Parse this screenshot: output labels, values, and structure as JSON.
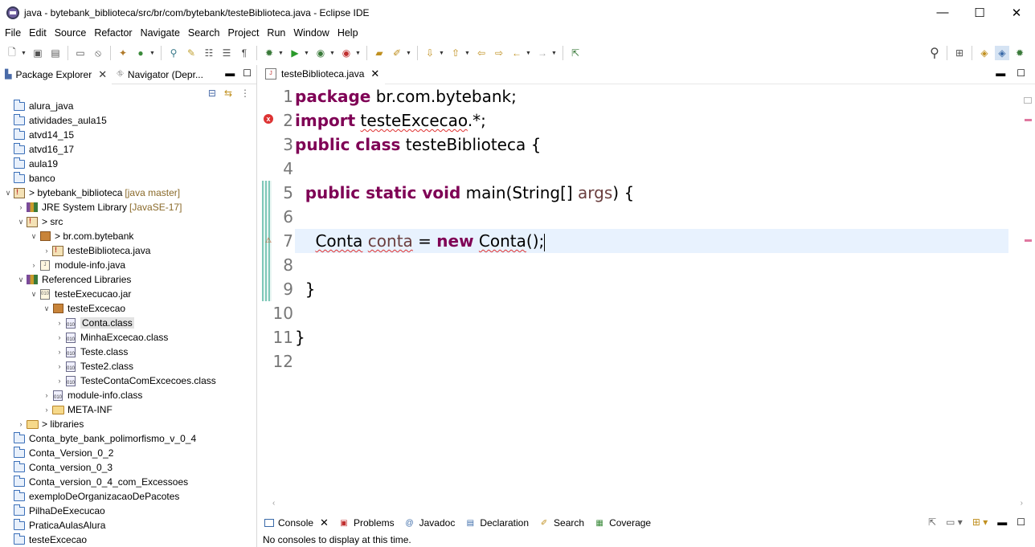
{
  "window": {
    "title": "java - bytebank_biblioteca/src/br/com/bytebank/testeBiblioteca.java - Eclipse IDE",
    "minimize": "—",
    "maximize": "☐",
    "close": "✕"
  },
  "menu": [
    "File",
    "Edit",
    "Source",
    "Refactor",
    "Navigate",
    "Search",
    "Project",
    "Run",
    "Window",
    "Help"
  ],
  "left_panel": {
    "tabs": [
      "Package Explorer",
      "Navigator (Depr..."
    ],
    "tree": [
      {
        "label": "alura_java",
        "icon": "project-folder-icon"
      },
      {
        "label": "atividades_aula15",
        "icon": "project-folder-icon"
      },
      {
        "label": "atvd14_15",
        "icon": "project-folder-icon"
      },
      {
        "label": "atvd16_17",
        "icon": "project-folder-icon"
      },
      {
        "label": "aula19",
        "icon": "project-folder-icon"
      },
      {
        "label": "banco",
        "icon": "project-folder-icon"
      },
      {
        "label": "> bytebank_biblioteca",
        "decoration": "[java master]",
        "icon": "java-project-icon"
      },
      {
        "label": "JRE System Library",
        "decoration": "[JavaSE-17]",
        "icon": "library-icon"
      },
      {
        "label": "> src",
        "icon": "source-folder-icon"
      },
      {
        "label": "> br.com.bytebank",
        "icon": "package-icon"
      },
      {
        "label": "testeBiblioteca.java",
        "icon": "java-file-icon"
      },
      {
        "label": "module-info.java",
        "icon": "java-file-icon"
      },
      {
        "label": "Referenced Libraries",
        "icon": "library-icon"
      },
      {
        "label": "testeExecucao.jar",
        "icon": "jar-icon"
      },
      {
        "label": "testeExcecao",
        "icon": "package-icon"
      },
      {
        "label": "Conta.class",
        "icon": "class-file-icon"
      },
      {
        "label": "MinhaExcecao.class",
        "icon": "class-file-icon"
      },
      {
        "label": "Teste.class",
        "icon": "class-file-icon"
      },
      {
        "label": "Teste2.class",
        "icon": "class-file-icon"
      },
      {
        "label": "TesteContaComExcecoes.class",
        "icon": "class-file-icon"
      },
      {
        "label": "module-info.class",
        "icon": "class-file-icon"
      },
      {
        "label": "META-INF",
        "icon": "folder-icon"
      },
      {
        "label": "> libraries",
        "icon": "folder-icon"
      },
      {
        "label": "Conta_byte_bank_polimorfismo_v_0_4",
        "icon": "project-folder-icon"
      },
      {
        "label": "Conta_Version_0_2",
        "icon": "project-folder-icon"
      },
      {
        "label": "Conta_version_0_3",
        "icon": "project-folder-icon"
      },
      {
        "label": "Conta_version_0_4_com_Excessoes",
        "icon": "project-folder-icon"
      },
      {
        "label": "exemploDeOrganizacaoDePacotes",
        "icon": "project-folder-icon"
      },
      {
        "label": "PilhaDeExecucao",
        "icon": "project-folder-icon"
      },
      {
        "label": "PraticaAulasAlura",
        "icon": "project-folder-icon"
      },
      {
        "label": "testeExcecao",
        "icon": "project-folder-icon"
      }
    ]
  },
  "editor": {
    "tab_label": "testeBiblioteca.java",
    "line_numbers": [
      "1",
      "2",
      "3",
      "4",
      "5",
      "6",
      "7",
      "8",
      "9",
      "10",
      "11",
      "12"
    ],
    "code": {
      "l1_kw": "package",
      "l1_rest": " br.com.bytebank;",
      "l2_kw": "import",
      "l2_pkg": "testeExcecao",
      "l2_rest": ".*;",
      "l3_kw": "public class",
      "l3_rest": " testeBiblioteca {",
      "l5_kw": "public static void",
      "l5_a": " main(String[] ",
      "l5_var": "args",
      "l5_b": ") {",
      "l7_type": "Conta",
      "l7_var": "conta",
      "l7_eq": " = ",
      "l7_kw": "new",
      "l7_ctor": "Conta",
      "l7_end": "();",
      "l9": "}",
      "l11": "}"
    }
  },
  "bottom_panel": {
    "tabs": [
      "Console",
      "Problems",
      "Javadoc",
      "Declaration",
      "Search",
      "Coverage"
    ],
    "message": "No consoles to display at this time."
  }
}
